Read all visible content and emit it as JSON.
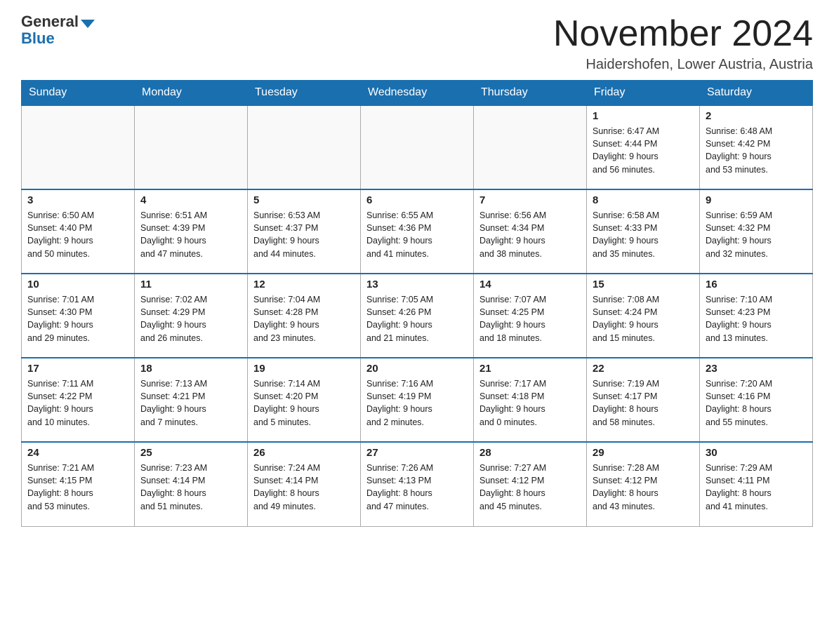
{
  "header": {
    "logo_general": "General",
    "logo_blue": "Blue",
    "month_title": "November 2024",
    "location": "Haidershofen, Lower Austria, Austria"
  },
  "weekdays": [
    "Sunday",
    "Monday",
    "Tuesday",
    "Wednesday",
    "Thursday",
    "Friday",
    "Saturday"
  ],
  "weeks": [
    [
      {
        "day": "",
        "info": ""
      },
      {
        "day": "",
        "info": ""
      },
      {
        "day": "",
        "info": ""
      },
      {
        "day": "",
        "info": ""
      },
      {
        "day": "",
        "info": ""
      },
      {
        "day": "1",
        "info": "Sunrise: 6:47 AM\nSunset: 4:44 PM\nDaylight: 9 hours\nand 56 minutes."
      },
      {
        "day": "2",
        "info": "Sunrise: 6:48 AM\nSunset: 4:42 PM\nDaylight: 9 hours\nand 53 minutes."
      }
    ],
    [
      {
        "day": "3",
        "info": "Sunrise: 6:50 AM\nSunset: 4:40 PM\nDaylight: 9 hours\nand 50 minutes."
      },
      {
        "day": "4",
        "info": "Sunrise: 6:51 AM\nSunset: 4:39 PM\nDaylight: 9 hours\nand 47 minutes."
      },
      {
        "day": "5",
        "info": "Sunrise: 6:53 AM\nSunset: 4:37 PM\nDaylight: 9 hours\nand 44 minutes."
      },
      {
        "day": "6",
        "info": "Sunrise: 6:55 AM\nSunset: 4:36 PM\nDaylight: 9 hours\nand 41 minutes."
      },
      {
        "day": "7",
        "info": "Sunrise: 6:56 AM\nSunset: 4:34 PM\nDaylight: 9 hours\nand 38 minutes."
      },
      {
        "day": "8",
        "info": "Sunrise: 6:58 AM\nSunset: 4:33 PM\nDaylight: 9 hours\nand 35 minutes."
      },
      {
        "day": "9",
        "info": "Sunrise: 6:59 AM\nSunset: 4:32 PM\nDaylight: 9 hours\nand 32 minutes."
      }
    ],
    [
      {
        "day": "10",
        "info": "Sunrise: 7:01 AM\nSunset: 4:30 PM\nDaylight: 9 hours\nand 29 minutes."
      },
      {
        "day": "11",
        "info": "Sunrise: 7:02 AM\nSunset: 4:29 PM\nDaylight: 9 hours\nand 26 minutes."
      },
      {
        "day": "12",
        "info": "Sunrise: 7:04 AM\nSunset: 4:28 PM\nDaylight: 9 hours\nand 23 minutes."
      },
      {
        "day": "13",
        "info": "Sunrise: 7:05 AM\nSunset: 4:26 PM\nDaylight: 9 hours\nand 21 minutes."
      },
      {
        "day": "14",
        "info": "Sunrise: 7:07 AM\nSunset: 4:25 PM\nDaylight: 9 hours\nand 18 minutes."
      },
      {
        "day": "15",
        "info": "Sunrise: 7:08 AM\nSunset: 4:24 PM\nDaylight: 9 hours\nand 15 minutes."
      },
      {
        "day": "16",
        "info": "Sunrise: 7:10 AM\nSunset: 4:23 PM\nDaylight: 9 hours\nand 13 minutes."
      }
    ],
    [
      {
        "day": "17",
        "info": "Sunrise: 7:11 AM\nSunset: 4:22 PM\nDaylight: 9 hours\nand 10 minutes."
      },
      {
        "day": "18",
        "info": "Sunrise: 7:13 AM\nSunset: 4:21 PM\nDaylight: 9 hours\nand 7 minutes."
      },
      {
        "day": "19",
        "info": "Sunrise: 7:14 AM\nSunset: 4:20 PM\nDaylight: 9 hours\nand 5 minutes."
      },
      {
        "day": "20",
        "info": "Sunrise: 7:16 AM\nSunset: 4:19 PM\nDaylight: 9 hours\nand 2 minutes."
      },
      {
        "day": "21",
        "info": "Sunrise: 7:17 AM\nSunset: 4:18 PM\nDaylight: 9 hours\nand 0 minutes."
      },
      {
        "day": "22",
        "info": "Sunrise: 7:19 AM\nSunset: 4:17 PM\nDaylight: 8 hours\nand 58 minutes."
      },
      {
        "day": "23",
        "info": "Sunrise: 7:20 AM\nSunset: 4:16 PM\nDaylight: 8 hours\nand 55 minutes."
      }
    ],
    [
      {
        "day": "24",
        "info": "Sunrise: 7:21 AM\nSunset: 4:15 PM\nDaylight: 8 hours\nand 53 minutes."
      },
      {
        "day": "25",
        "info": "Sunrise: 7:23 AM\nSunset: 4:14 PM\nDaylight: 8 hours\nand 51 minutes."
      },
      {
        "day": "26",
        "info": "Sunrise: 7:24 AM\nSunset: 4:14 PM\nDaylight: 8 hours\nand 49 minutes."
      },
      {
        "day": "27",
        "info": "Sunrise: 7:26 AM\nSunset: 4:13 PM\nDaylight: 8 hours\nand 47 minutes."
      },
      {
        "day": "28",
        "info": "Sunrise: 7:27 AM\nSunset: 4:12 PM\nDaylight: 8 hours\nand 45 minutes."
      },
      {
        "day": "29",
        "info": "Sunrise: 7:28 AM\nSunset: 4:12 PM\nDaylight: 8 hours\nand 43 minutes."
      },
      {
        "day": "30",
        "info": "Sunrise: 7:29 AM\nSunset: 4:11 PM\nDaylight: 8 hours\nand 41 minutes."
      }
    ]
  ]
}
